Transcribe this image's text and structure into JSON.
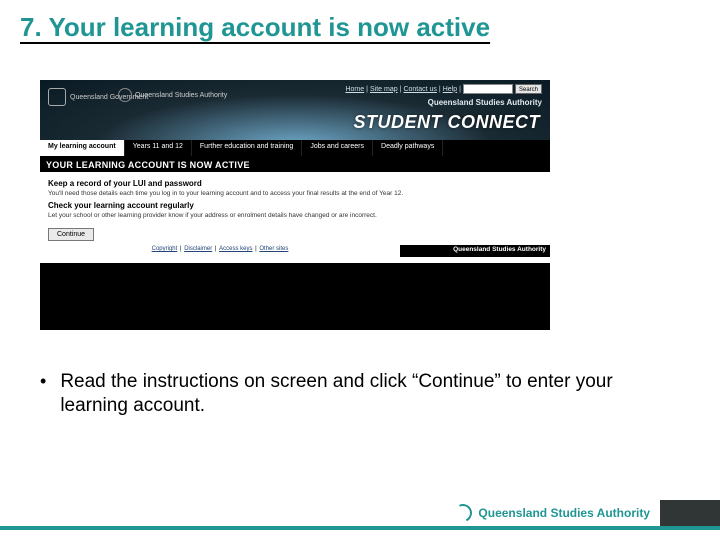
{
  "slide": {
    "title": "7. Your learning account is now active",
    "bullet": "Read the instructions on screen and click “Continue” to enter your learning account."
  },
  "screenshot": {
    "logos": {
      "gov": "Queensland Government",
      "qsa": "Queensland Studies Authority"
    },
    "top_links": [
      "Home",
      "Site map",
      "Contact us",
      "Help"
    ],
    "search_button": "Search",
    "sub_brand": "Queensland Studies Authority",
    "hero": "STUDENT CONNECT",
    "tabs": [
      "My learning account",
      "Years 11 and 12",
      "Further education and training",
      "Jobs and careers",
      "Deadly pathways"
    ],
    "banner": "YOUR LEARNING ACCOUNT IS NOW ACTIVE",
    "h_keep": "Keep a record of your LUI and password",
    "p_need": "You'll need those details each time you log in to your learning account and to access your final results at the end of Year 12.",
    "h_check": "Check your learning account regularly",
    "p_let": "Let your school or other learning provider know if your address or enrolment details have changed or are incorrect.",
    "continue": "Continue",
    "footer_links": [
      "Copyright",
      "Disclaimer",
      "Access keys",
      "Other sites"
    ],
    "footer_brand": "Queensland Studies Authority"
  },
  "brand": {
    "name": "Queensland Studies Authority"
  }
}
